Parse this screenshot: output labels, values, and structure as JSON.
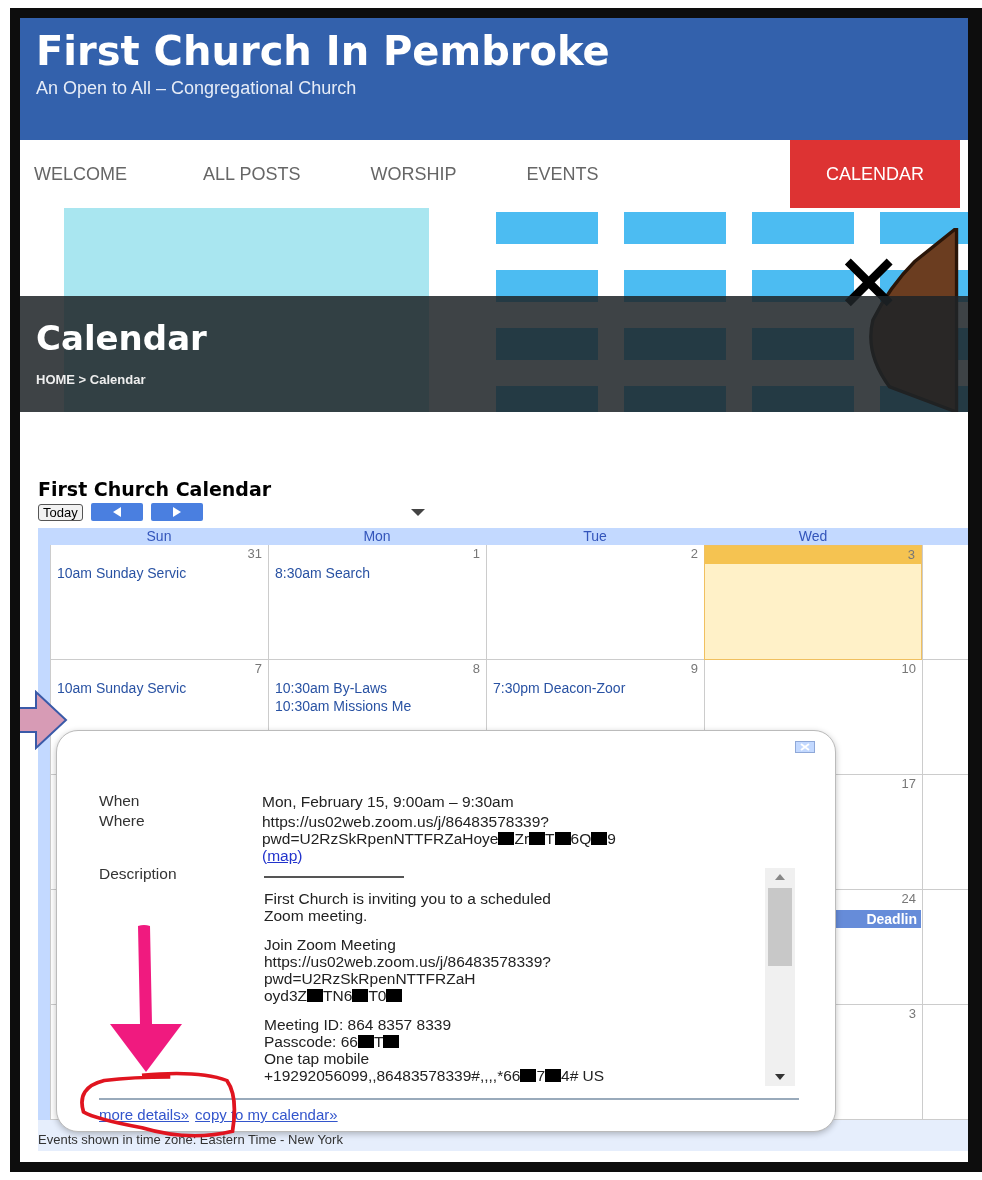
{
  "site": {
    "title": "First Church In Pembroke",
    "tagline": "An Open to All – Congregational Church"
  },
  "nav": [
    {
      "label": "WELCOME",
      "selected": false
    },
    {
      "label": "ALL POSTS",
      "selected": false
    },
    {
      "label": "WORSHIP",
      "selected": false
    },
    {
      "label": "EVENTS",
      "selected": false
    },
    {
      "label": "CALENDAR",
      "selected": true
    }
  ],
  "hero": {
    "title": "Calendar",
    "breadcrumb": "HOME > Calendar"
  },
  "calendar": {
    "title": "First Church Calendar",
    "today_button": "Today",
    "weekdays": [
      "Sun",
      "Mon",
      "Tue",
      "Wed"
    ],
    "weeks": [
      {
        "days": [
          {
            "number": "31",
            "today": false,
            "events": [
              {
                "text": "10am Sunday Servic",
                "kind": "timed"
              }
            ]
          },
          {
            "number": "1",
            "today": false,
            "events": [
              {
                "text": "8:30am Search",
                "kind": "timed"
              }
            ]
          },
          {
            "number": "2",
            "today": false
          },
          {
            "number": "3",
            "today": true
          }
        ]
      },
      {
        "days": [
          {
            "number": "7",
            "today": false,
            "events": [
              {
                "text": "10am Sunday Servic",
                "kind": "timed"
              }
            ]
          },
          {
            "number": "8",
            "today": false,
            "events": [
              {
                "text": "10:30am By-Laws",
                "kind": "timed"
              },
              {
                "text": "10:30am Missions Me",
                "kind": "timed"
              }
            ]
          },
          {
            "number": "9",
            "today": false,
            "events": [
              {
                "text": "7:30pm Deacon-Zoor",
                "kind": "timed"
              }
            ]
          },
          {
            "number": "10",
            "today": false
          }
        ]
      },
      {
        "days": [
          {
            "number": "17",
            "today": false
          }
        ]
      },
      {
        "days": [
          {
            "number": "24",
            "today": false,
            "events": [
              {
                "text": "Deadlin",
                "kind": "allday"
              }
            ]
          }
        ]
      },
      {
        "days": [
          {
            "number": "3",
            "today": false
          }
        ]
      }
    ],
    "timezone": "Events shown in time zone: Eastern Time - New York"
  },
  "popup": {
    "when_label": "When",
    "when": "Mon, February 15, 9:00am – 9:30am",
    "where_label": "Where",
    "where_lines": [
      [
        {
          "kind": "text",
          "text": "https://us02web.zoom.us/j/86483578339?"
        }
      ],
      [
        {
          "kind": "text",
          "text": "pwd=U2RzSkRpenNTTFRZaHoye"
        },
        {
          "kind": "redaction"
        },
        {
          "kind": "text",
          "text": "Zr"
        },
        {
          "kind": "redaction"
        },
        {
          "kind": "text",
          "text": "T"
        },
        {
          "kind": "redaction"
        },
        {
          "kind": "text",
          "text": "6Q"
        },
        {
          "kind": "redaction"
        },
        {
          "kind": "text",
          "text": "9"
        }
      ]
    ],
    "map_line": {
      "before": "(",
      "link": "map",
      "after": ")"
    },
    "description_label": "Description",
    "description": [
      [
        [
          {
            "kind": "text",
            "text": "First Church is inviting you to a scheduled"
          }
        ],
        [
          {
            "kind": "text",
            "text": "Zoom meeting."
          }
        ]
      ],
      [
        [
          {
            "kind": "text",
            "text": "Join Zoom Meeting"
          }
        ],
        [
          {
            "kind": "text",
            "text": "https://us02web.zoom.us/j/86483578339?"
          }
        ],
        [
          {
            "kind": "text",
            "text": "pwd=U2RzSkRpenNTTFRZaH"
          }
        ],
        [
          {
            "kind": "text",
            "text": "oyd3Z"
          },
          {
            "kind": "redaction"
          },
          {
            "kind": "text",
            "text": "TN6"
          },
          {
            "kind": "redaction"
          },
          {
            "kind": "text",
            "text": "T0"
          },
          {
            "kind": "redaction"
          }
        ]
      ],
      [
        [
          {
            "kind": "text",
            "text": "Meeting ID: 864 8357 8339"
          }
        ],
        [
          {
            "kind": "text",
            "text": "Passcode: 66"
          },
          {
            "kind": "redaction"
          },
          {
            "kind": "text",
            "text": "T"
          },
          {
            "kind": "redaction"
          }
        ],
        [
          {
            "kind": "text",
            "text": "One tap mobile"
          }
        ],
        [
          {
            "kind": "text",
            "text": "+19292056099,,86483578339#,,,,*66"
          },
          {
            "kind": "redaction"
          },
          {
            "kind": "text",
            "text": "7"
          },
          {
            "kind": "redaction"
          },
          {
            "kind": "text",
            "text": "4# US"
          }
        ]
      ]
    ],
    "links": [
      "more details»",
      "copy to my calendar»"
    ]
  }
}
